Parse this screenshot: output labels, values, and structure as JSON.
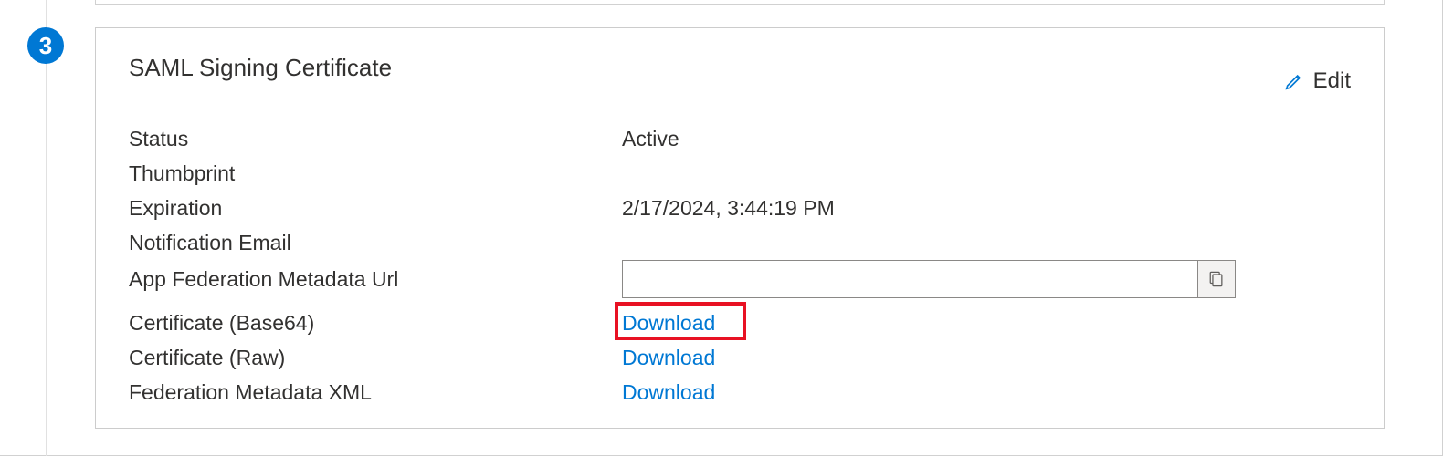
{
  "step_number": "3",
  "card": {
    "title": "SAML Signing Certificate",
    "edit_label": "Edit",
    "fields": {
      "status_label": "Status",
      "status_value": "Active",
      "thumbprint_label": "Thumbprint",
      "thumbprint_value": "",
      "expiration_label": "Expiration",
      "expiration_value": "2/17/2024, 3:44:19 PM",
      "notification_email_label": "Notification Email",
      "notification_email_value": "",
      "federation_url_label": "App Federation Metadata Url",
      "federation_url_value": "",
      "cert_base64_label": "Certificate (Base64)",
      "cert_base64_link": "Download",
      "cert_raw_label": "Certificate (Raw)",
      "cert_raw_link": "Download",
      "fed_xml_label": "Federation Metadata XML",
      "fed_xml_link": "Download"
    }
  }
}
